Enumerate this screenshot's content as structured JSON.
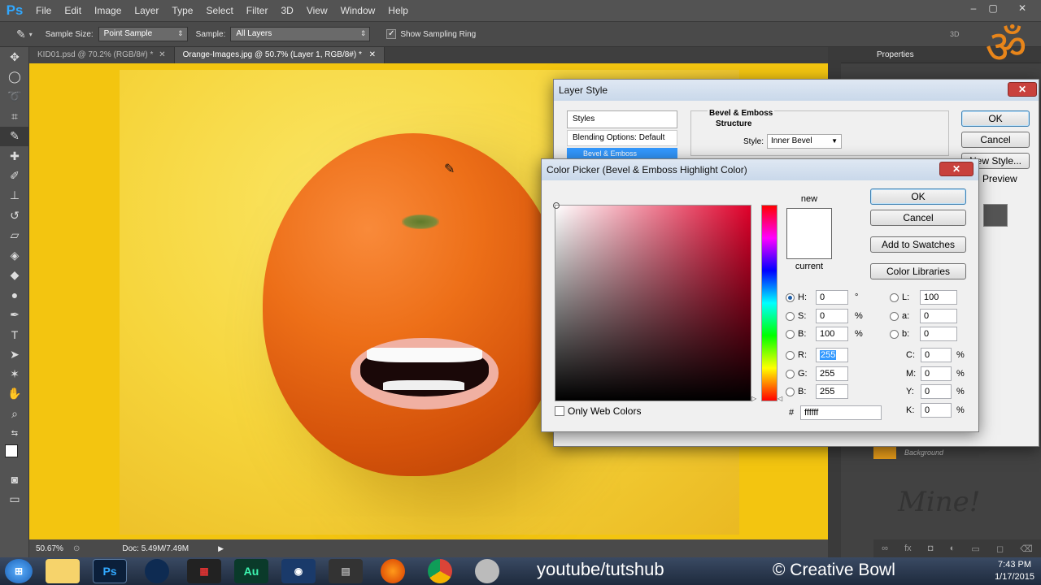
{
  "app": {
    "logo": "Ps",
    "menu": [
      "File",
      "Edit",
      "Image",
      "Layer",
      "Type",
      "Select",
      "Filter",
      "3D",
      "View",
      "Window",
      "Help"
    ],
    "window_controls": [
      "–",
      "▢",
      "✕"
    ]
  },
  "options_bar": {
    "sample_size_label": "Sample Size:",
    "sample_size_value": "Point Sample",
    "sample_label": "Sample:",
    "sample_value": "All Layers",
    "show_sampling_ring_label": "Show Sampling Ring",
    "show_sampling_ring_checked": true,
    "workspace_label": "3D"
  },
  "tabs": [
    {
      "label": "KID01.psd @ 70.2% (RGB/8#) *",
      "close": "✕",
      "active": false
    },
    {
      "label": "Orange-Images.jpg @ 50.7% (Layer 1, RGB/8#) *",
      "close": "✕",
      "active": true
    }
  ],
  "status_bar": {
    "zoom": "50.67%",
    "doc_size": "Doc: 5.49M/7.49M"
  },
  "right_panel": {
    "title": "Properties",
    "layer_name": "Background"
  },
  "layer_style_dialog": {
    "title": "Layer Style",
    "styles_header": "Styles",
    "blending_options": "Blending Options: Default",
    "bevel_emboss_item": "Bevel & Emboss",
    "section_title": "Bevel & Emboss",
    "subsection": "Structure",
    "style_label": "Style:",
    "style_value": "Inner Bevel",
    "ok": "OK",
    "cancel": "Cancel",
    "new_style": "New Style...",
    "preview": "Preview"
  },
  "color_picker": {
    "title": "Color Picker (Bevel & Emboss Highlight Color)",
    "new_label": "new",
    "current_label": "current",
    "new_color": "#ffffff",
    "current_color": "#ffffff",
    "ok": "OK",
    "cancel": "Cancel",
    "add_to_swatches": "Add to Swatches",
    "color_libraries": "Color Libraries",
    "hue_field_color": "#e0002a",
    "fields": {
      "H": {
        "label": "H:",
        "value": "0",
        "unit": "°",
        "selected": true
      },
      "S": {
        "label": "S:",
        "value": "0",
        "unit": "%"
      },
      "Bv": {
        "label": "B:",
        "value": "100",
        "unit": "%"
      },
      "R": {
        "label": "R:",
        "value": "255"
      },
      "G": {
        "label": "G:",
        "value": "255"
      },
      "Bc": {
        "label": "B:",
        "value": "255"
      },
      "L": {
        "label": "L:",
        "value": "100"
      },
      "a": {
        "label": "a:",
        "value": "0"
      },
      "b": {
        "label": "b:",
        "value": "0"
      },
      "C": {
        "label": "C:",
        "value": "0",
        "unit": "%"
      },
      "M": {
        "label": "M:",
        "value": "0",
        "unit": "%"
      },
      "Y": {
        "label": "Y:",
        "value": "0",
        "unit": "%"
      },
      "K": {
        "label": "K:",
        "value": "0",
        "unit": "%"
      }
    },
    "hex_label": "#",
    "hex_value": "ffffff",
    "only_web_colors": "Only Web Colors"
  },
  "watermarks": {
    "youtube": "youtube/tutshub",
    "creative": "© Creative Bowl",
    "signature": "Mine!"
  },
  "taskbar": {
    "icons": [
      "windows-start",
      "file-explorer",
      "photoshop",
      "media-player",
      "video-editor",
      "audition",
      "screen-recorder",
      "sound-editor",
      "firefox",
      "chrome",
      "utility"
    ],
    "ps_label": "Ps",
    "au_label": "Au",
    "time": "7:43 PM",
    "date": "1/17/2015"
  }
}
